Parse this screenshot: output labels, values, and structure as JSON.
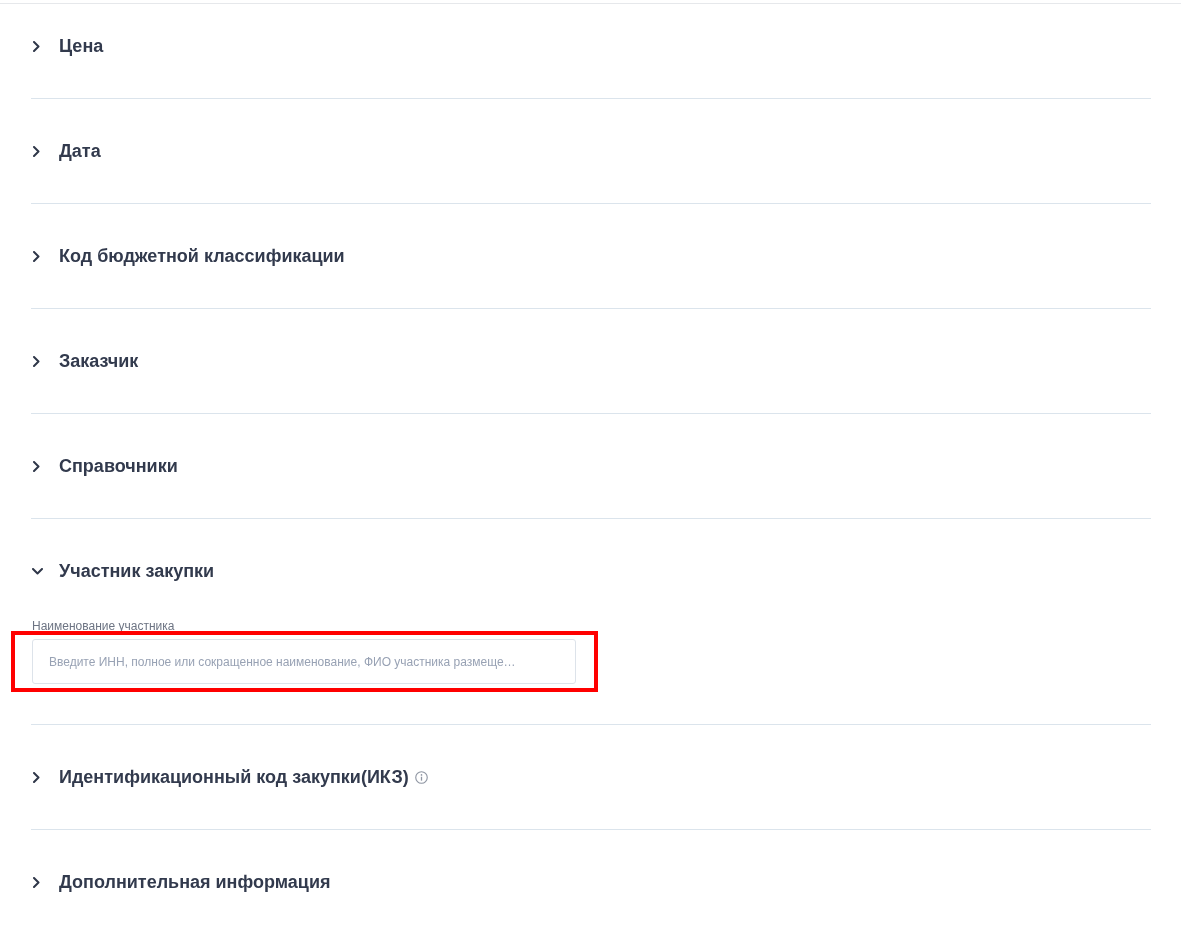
{
  "sections": [
    {
      "title": "Цена",
      "expanded": false,
      "info": false
    },
    {
      "title": "Дата",
      "expanded": false,
      "info": false
    },
    {
      "title": "Код бюджетной классификации",
      "expanded": false,
      "info": false
    },
    {
      "title": "Заказчик",
      "expanded": false,
      "info": false
    },
    {
      "title": "Справочники",
      "expanded": false,
      "info": false
    },
    {
      "title": "Участник закупки",
      "expanded": true,
      "info": false,
      "fields": [
        {
          "label": "Наименование участника",
          "placeholder": "Введите ИНН, полное или сокращенное наименование, ФИО участника размеще…",
          "highlighted": true
        }
      ]
    },
    {
      "title": "Идентификационный код закупки(ИКЗ)",
      "expanded": false,
      "info": true
    },
    {
      "title": "Дополнительная информация",
      "expanded": false,
      "info": false
    }
  ]
}
